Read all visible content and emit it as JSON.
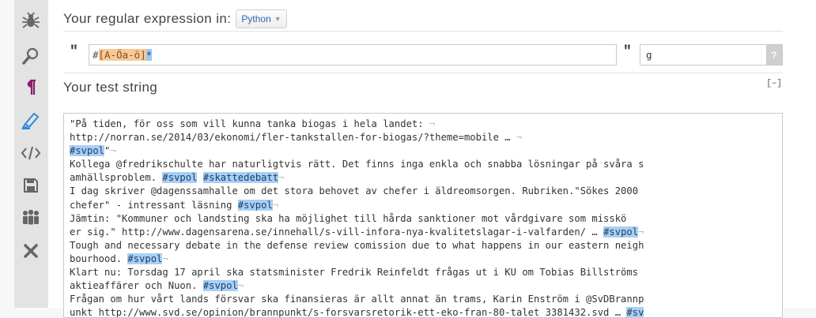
{
  "sidebar": {
    "items": [
      {
        "icon": "bug-icon"
      },
      {
        "icon": "magnifier-icon"
      },
      {
        "icon": "pilcrow-icon",
        "color": "#8b1f6b"
      },
      {
        "icon": "highlighter-icon",
        "color": "#2f8ad8",
        "active": true
      },
      {
        "icon": "code-icon"
      },
      {
        "icon": "save-icon"
      },
      {
        "icon": "users-icon"
      },
      {
        "icon": "close-icon"
      }
    ]
  },
  "regex": {
    "title": "Your regular expression in:",
    "flavor": "Python",
    "open_quote": "\"",
    "close_quote": "\"",
    "pattern_hash": "#",
    "pattern_class": "[A-Öa-ö]",
    "pattern_quant": "*",
    "flags": "g",
    "help": "?"
  },
  "test": {
    "title": "Your test string",
    "collapse": "[–]",
    "lines": [
      [
        {
          "t": "\"På tiden, för oss som vill kunna tanka biogas i hela landet: "
        },
        {
          "t": "¬",
          "eol": true
        }
      ],
      [
        {
          "t": "http://norran.se/2014/03/ekonomi/fler-tankstallen-for-biogas/?theme=mobile … "
        },
        {
          "t": "¬",
          "eol": true
        }
      ],
      [
        {
          "t": "#svpol",
          "m": true
        },
        {
          "t": "\""
        },
        {
          "t": "¬",
          "eol": true
        }
      ],
      [
        {
          "t": "Kollega @fredrikschulte har naturligtvis rätt. Det finns inga enkla och snabba lösningar på svåra s"
        }
      ],
      [
        {
          "t": "amhällsproblem. "
        },
        {
          "t": "#svpol",
          "m": true
        },
        {
          "t": " "
        },
        {
          "t": "#skattedebatt",
          "m": true
        },
        {
          "t": "¬",
          "eol": true
        }
      ],
      [
        {
          "t": "I dag skriver @dagenssamhalle om det stora behovet av chefer i äldreomsorgen. Rubriken.\"Sökes 2000 "
        }
      ],
      [
        {
          "t": "chefer\" - intressant läsning "
        },
        {
          "t": "#svpol",
          "m": true
        },
        {
          "t": "¬",
          "eol": true
        }
      ],
      [
        {
          "t": "Jämtin: \"Kommuner och landsting ska ha möjlighet till hårda sanktioner mot vårdgivare som misskö"
        }
      ],
      [
        {
          "t": "er sig.\" http://www.dagensarena.se/innehall/s-vill-infora-nya-kvalitetslagar-i-valfarden/ … "
        },
        {
          "t": "#svpol",
          "m": true
        },
        {
          "t": "¬",
          "eol": true
        }
      ],
      [
        {
          "t": "Tough and necessary debate in the defense review comission due to what happens in our eastern neigh"
        }
      ],
      [
        {
          "t": "bourhood. "
        },
        {
          "t": "#svpol",
          "m": true
        },
        {
          "t": "¬",
          "eol": true
        }
      ],
      [
        {
          "t": "Klart nu: Torsdag 17 april ska statsminister Fredrik Reinfeldt frågas ut i KU om Tobias Billströms "
        }
      ],
      [
        {
          "t": "aktieaffärer och Nuon. "
        },
        {
          "t": "#svpol",
          "m": true
        },
        {
          "t": "¬",
          "eol": true
        }
      ],
      [
        {
          "t": "Frågan om hur vårt lands försvar ska finansieras är allt annat än trams, Karin Enström i @SvDBrannp"
        }
      ],
      [
        {
          "t": "unkt http://www.svd.se/opinion/brannpunkt/s-forsvarsretorik-ett-eko-fran-80-talet_3381432.svd … "
        },
        {
          "t": "#sv",
          "m": true
        }
      ]
    ]
  }
}
